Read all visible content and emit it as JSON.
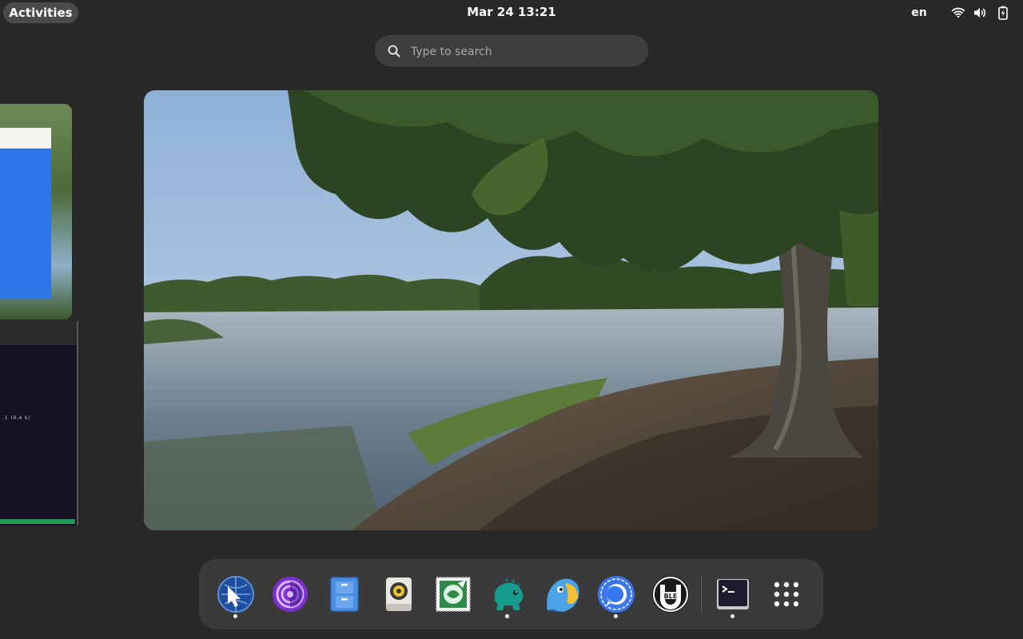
{
  "topbar": {
    "activities_label": "Activities",
    "clock": "Mar 24  13:21",
    "input_language": "en",
    "tray_icons": [
      "wifi-icon",
      "volume-icon",
      "battery-icon"
    ]
  },
  "search": {
    "placeholder": "Type to search",
    "value": ""
  },
  "workspaces": {
    "left_window": "terminal-and-dialog",
    "main_window": "lake-landscape-wallpaper",
    "left_terminal_text": ".1 (0.4 k)"
  },
  "dock": {
    "apps": [
      {
        "icon": "web-browser-icon",
        "running": true
      },
      {
        "icon": "tor-browser-icon",
        "running": false
      },
      {
        "icon": "file-cabinet-icon",
        "running": false
      },
      {
        "icon": "speaker-icon",
        "running": false
      },
      {
        "icon": "mail-stamp-icon",
        "running": false
      },
      {
        "icon": "dinosaur-icon",
        "running": true
      },
      {
        "icon": "parrot-icon",
        "running": false
      },
      {
        "icon": "signal-messenger-icon",
        "running": true
      },
      {
        "icon": "ble-icon",
        "running": false
      },
      {
        "icon": "terminal-icon",
        "running": true
      },
      {
        "icon": "app-grid-icon",
        "running": false
      }
    ]
  },
  "colors": {
    "panel_bg": "#292929",
    "dock_bg": "#3a3a3a",
    "signal_blue": "#3a76f0",
    "accent_blue": "#2f74e6"
  }
}
